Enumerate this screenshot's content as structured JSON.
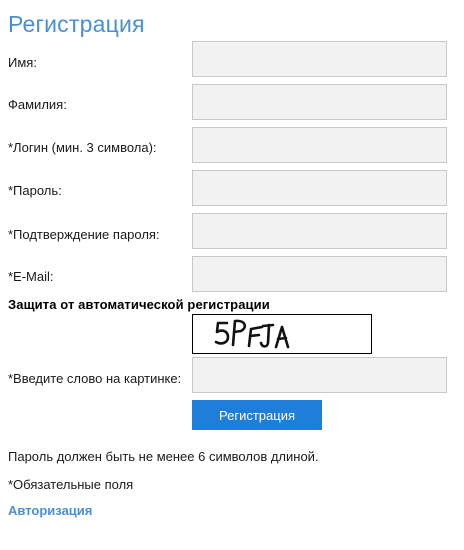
{
  "title": "Регистрация",
  "fields": [
    {
      "label": "Имя:",
      "value": "",
      "required": false
    },
    {
      "label": "Фамилия:",
      "value": "",
      "required": false
    },
    {
      "label": "*Логин (мин. 3 символа):",
      "value": "",
      "required": true
    },
    {
      "label": "*Пароль:",
      "value": "",
      "required": true
    },
    {
      "label": "*Подтверждение пароля:",
      "value": "",
      "required": true
    },
    {
      "label": "*E-Mail:",
      "value": "",
      "required": true
    }
  ],
  "captcha": {
    "heading": "Защита от автоматической регистрации",
    "image_text": "5PFJA",
    "input_label": "*Введите слово на картинке:",
    "input_value": ""
  },
  "submit_label": "Регистрация",
  "notes": {
    "password_hint": "Пароль должен быть не менее 6 символов длиной.",
    "required_hint": "*Обязательные поля"
  },
  "auth_link_label": "Авторизация",
  "colors": {
    "title": "#4a90d0",
    "button": "#1e7ed8",
    "link": "#4a90d0",
    "input_bg": "#f2f2f2",
    "input_border": "#c8c8c8"
  }
}
